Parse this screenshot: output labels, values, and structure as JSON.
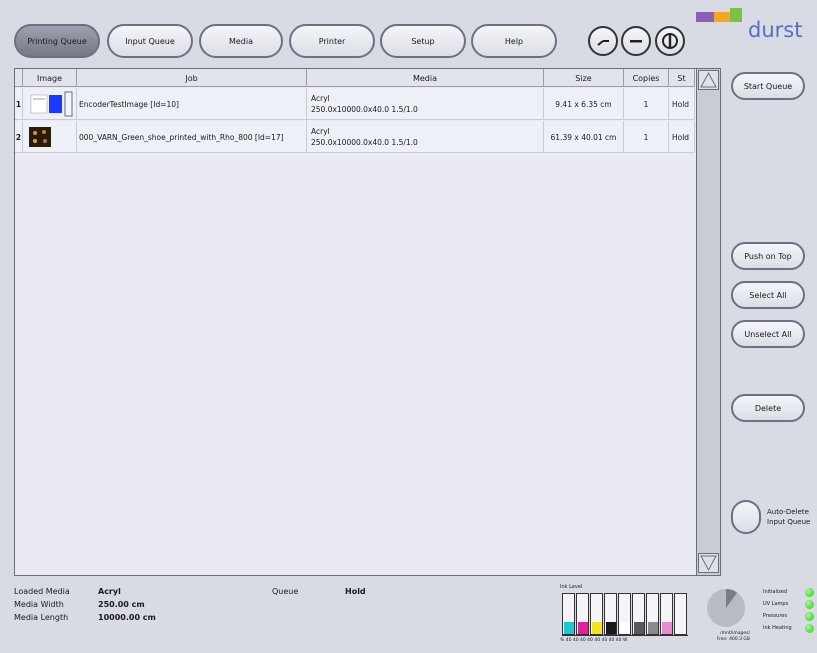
{
  "tabs": [
    {
      "label": "Printing Queue",
      "active": true
    },
    {
      "label": "Input Queue",
      "active": false
    },
    {
      "label": "Media",
      "active": false
    },
    {
      "label": "Printer",
      "active": false
    },
    {
      "label": "Setup",
      "active": false
    },
    {
      "label": "Help",
      "active": false
    }
  ],
  "header_icons": [
    "clock-icon",
    "minus-icon",
    "power-icon"
  ],
  "logo": {
    "text": "durst",
    "colors": [
      "#8b5fb8",
      "#f5a623",
      "#7cc242"
    ]
  },
  "table": {
    "columns": [
      "Image",
      "Job",
      "Media",
      "Size",
      "Copies",
      "St"
    ],
    "rows": [
      {
        "num": "1",
        "job": "EncoderTestImage [Id=10]",
        "media_name": "Acryl",
        "media_spec": "250.0x10000.0x40.0 1.5/1.0",
        "size": "9.41 x 6.35 cm",
        "copies": "1",
        "status": "Hold"
      },
      {
        "num": "2",
        "job": "000_VARN_Green_shoe_printed_with_Rho_800 [Id=17]",
        "media_name": "Acryl",
        "media_spec": "250.0x10000.0x40.0 1.5/1.0",
        "size": "61.39 x 40.01 cm",
        "copies": "1",
        "status": "Hold"
      }
    ]
  },
  "side_buttons": {
    "start_queue": "Start Queue",
    "push_on_top": "Push on Top",
    "select_all": "Select All",
    "unselect_all": "Unselect All",
    "delete": "Delete",
    "auto_delete_line1": "Auto-Delete",
    "auto_delete_line2": "Input Queue"
  },
  "status": {
    "loaded_media_label": "Loaded Media",
    "loaded_media_value": "Acryl",
    "media_width_label": "Media Width",
    "media_width_value": "250.00 cm",
    "media_length_label": "Media Length",
    "media_length_value": "10000.00 cm",
    "queue_label": "Queue",
    "queue_value": "Hold"
  },
  "ink": {
    "title": "Ink Level",
    "scale_text": "% 40  40  40  40  40  40  40  40  W",
    "channels": [
      {
        "color": "#19c9d8",
        "level": 0.3
      },
      {
        "color": "#e61ea0",
        "level": 0.3
      },
      {
        "color": "#f2e41a",
        "level": 0.3
      },
      {
        "color": "#1a1a1a",
        "level": 0.3
      },
      {
        "color": "#ffffff",
        "level": 0.3
      },
      {
        "color": "#5a5a5a",
        "level": 0.3
      },
      {
        "color": "#8a8a8a",
        "level": 0.3
      },
      {
        "color": "#e88ad0",
        "level": 0.3
      },
      {
        "color": "#ffffff",
        "level": 0.0
      }
    ]
  },
  "disk": {
    "line1": "/mnt/images/",
    "line2": "Free: 400.3 GB",
    "used_fraction": 0.1
  },
  "indicators": [
    {
      "label": "Initialized",
      "color": "#2fc41e"
    },
    {
      "label": "UV Lamps",
      "color": "#2fc41e"
    },
    {
      "label": "Pressures",
      "color": "#2fc41e"
    },
    {
      "label": "Ink Heating",
      "color": "#2fc41e"
    }
  ]
}
